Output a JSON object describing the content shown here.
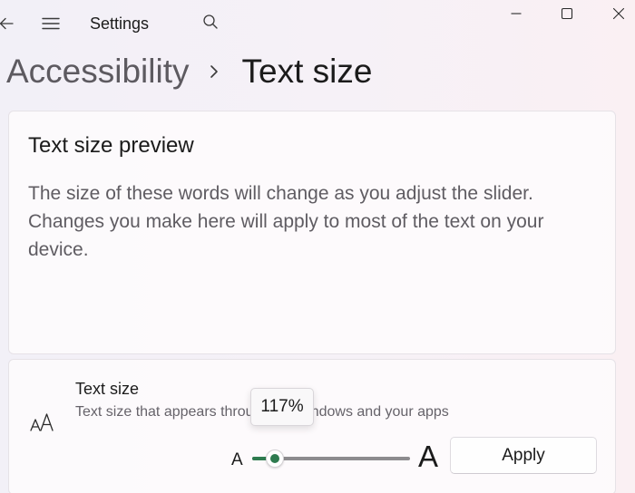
{
  "titlebar": {
    "app_title": "Settings",
    "icons": {
      "back": "back-arrow-icon",
      "menu": "hamburger-menu-icon",
      "search": "search-icon",
      "minimize": "minimize-icon",
      "maximize": "maximize-icon",
      "close": "close-icon"
    }
  },
  "breadcrumb": {
    "parent": "Accessibility",
    "separator_icon": "chevron-right-icon",
    "current": "Text size"
  },
  "preview": {
    "title": "Text size preview",
    "body": "The size of these words will change as you adjust the slider. Changes you make here will apply to most of the text on your device."
  },
  "text_size_setting": {
    "icon": "text-size-icon",
    "label": "Text size",
    "description": "Text size that appears throughout Windows and your apps",
    "slider": {
      "min_label": "A",
      "max_label": "A",
      "value_percent": 117,
      "min_percent": 100,
      "max_percent": 225,
      "tooltip": "117%"
    },
    "apply_label": "Apply"
  },
  "colors": {
    "accent": "#2e7b4f",
    "track": "#8d8b8e"
  }
}
